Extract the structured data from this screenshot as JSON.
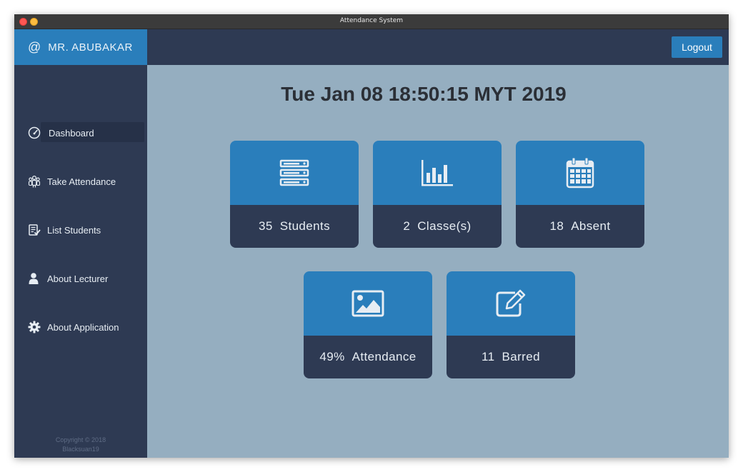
{
  "window": {
    "title": "Attendance System"
  },
  "header": {
    "at_symbol": "@",
    "user_name": "MR. ABUBAKAR",
    "logout_label": "Logout"
  },
  "sidebar": {
    "items": [
      {
        "label": "Dashboard",
        "icon": "dashboard-gauge-icon",
        "active": true
      },
      {
        "label": "Take Attendance",
        "icon": "group-icon",
        "active": false
      },
      {
        "label": "List Students",
        "icon": "checklist-icon",
        "active": false
      },
      {
        "label": "About Lecturer",
        "icon": "user-icon",
        "active": false
      },
      {
        "label": "About Application",
        "icon": "gear-icon",
        "active": false
      }
    ],
    "copyright_line1": "Copyright © 2018",
    "copyright_line2": "Blacksuan19"
  },
  "main": {
    "datetime": "Tue Jan 08 18:50:15 MYT 2019",
    "cards": [
      {
        "value": "35",
        "label": "Students",
        "icon": "server-stack-icon"
      },
      {
        "value": "2",
        "label": "Classe(s)",
        "icon": "bar-chart-icon"
      },
      {
        "value": "18",
        "label": "Absent",
        "icon": "calendar-icon"
      },
      {
        "value": "49%",
        "label": "Attendance",
        "icon": "image-icon"
      },
      {
        "value": "11",
        "label": "Barred",
        "icon": "edit-icon"
      }
    ]
  },
  "colors": {
    "accent": "#2a7ebb",
    "navy": "#2e3a53",
    "content_bg": "#95aec0"
  }
}
